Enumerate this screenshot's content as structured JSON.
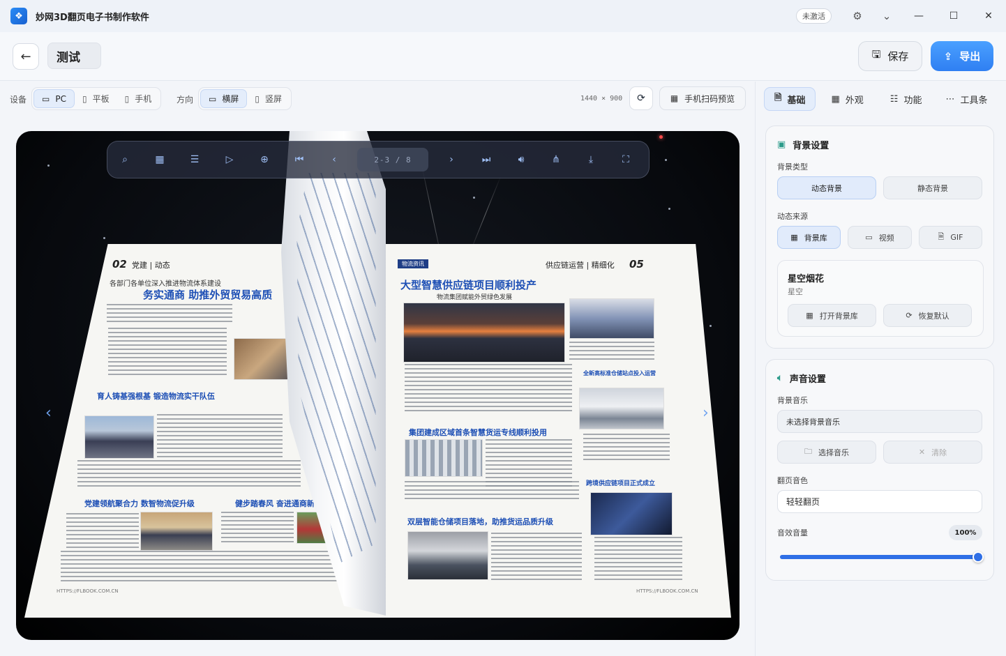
{
  "app": {
    "title": "妙网3D翻页电子书制作软件",
    "logo_icon": "book-wing-icon"
  },
  "titlebar": {
    "badge": "未激活",
    "icons": [
      "gear-icon",
      "chevron-down-icon",
      "minimize-icon",
      "maximize-icon",
      "close-icon"
    ]
  },
  "header": {
    "doc_title": "测试",
    "save_label": "保存",
    "export_label": "导出"
  },
  "toolbar": {
    "device_label": "设备",
    "devices": [
      {
        "label": "PC",
        "icon": "monitor-icon",
        "active": true
      },
      {
        "label": "平板",
        "icon": "tablet-icon",
        "active": false
      },
      {
        "label": "手机",
        "icon": "phone-icon",
        "active": false
      }
    ],
    "orientation_label": "方向",
    "orientations": [
      {
        "label": "横屏",
        "icon": "landscape-icon",
        "active": true
      },
      {
        "label": "竖屏",
        "icon": "portrait-icon",
        "active": false
      }
    ],
    "resolution": "1440 × 900",
    "qr_preview_label": "手机扫码预览"
  },
  "viewer": {
    "page_indicator": "2-3 / 8",
    "controls": [
      "search-icon",
      "thumbnails-icon",
      "toc-icon",
      "play-icon",
      "zoom-in-icon",
      "first-page-icon",
      "prev-page-icon",
      "next-page-icon",
      "last-page-icon",
      "sound-icon",
      "share-icon",
      "download-icon",
      "fullscreen-icon"
    ]
  },
  "book": {
    "left_page": {
      "number": "02",
      "section": "党建 | 动态",
      "intro": "各部门各单位深入推进物流体系建设",
      "headline": "务实通商 助推外贸贸易高质",
      "headline2": "育人铸基强根基 锻造物流实干队伍",
      "headline3": "党建领航聚合力 数智物流促升级",
      "headline4": "健步踏春风 奋进通商新征途",
      "footer": "HTTPS://FLBOOK.COM.CN"
    },
    "right_page": {
      "number": "05",
      "section": "供应链运营 | 精细化",
      "masthead": "物流资讯",
      "headline": "大型智慧供应链项目顺利投产",
      "subheadline": "物流集团赋能外贸绿色发展",
      "headline2": "集团建成区域首条智慧货运专线顺利投用",
      "headline3": "双层智能仓储项目落地，助推货运品质升级",
      "sidebar1": "全新高标准仓储站点投入运营",
      "sidebar2": "跨境供应链项目正式成立",
      "footer": "HTTPS://FLBOOK.COM.CN"
    }
  },
  "side_panel": {
    "tabs": [
      {
        "label": "基础",
        "icon": "doc-icon",
        "active": true
      },
      {
        "label": "外观",
        "icon": "grid-icon",
        "active": false
      },
      {
        "label": "功能",
        "icon": "sliders-icon",
        "active": false
      },
      {
        "label": "工具条",
        "icon": "dots-icon",
        "active": false
      }
    ],
    "background": {
      "title": "背景设置",
      "type_label": "背景类型",
      "types": [
        "动态背景",
        "静态背景"
      ],
      "source_label": "动态来源",
      "sources": [
        "背景库",
        "视频",
        "GIF"
      ],
      "current_name": "星空烟花",
      "current_sub": "星空",
      "open_library": "打开背景库",
      "restore_default": "恢复默认"
    },
    "sound": {
      "title": "声音设置",
      "music_label": "背景音乐",
      "music_value": "未选择背景音乐",
      "choose_music": "选择音乐",
      "clear": "清除",
      "flip_sound_label": "翻页音色",
      "flip_sound_value": "轻轻翻页",
      "volume_label": "音效音量",
      "volume_value": "100%",
      "volume": 1.0
    }
  },
  "colors": {
    "accent": "#2f7ff2",
    "headline_blue": "#1d4fb5",
    "active_tab_bg": "#e4edfb"
  }
}
